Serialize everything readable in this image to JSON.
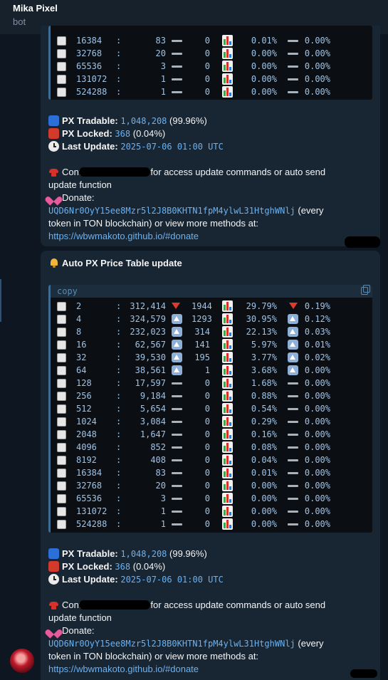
{
  "chat": {
    "name": "Mika Pixel",
    "subtitle": "bot"
  },
  "message1": {
    "table_rows": [
      {
        "power": "16384",
        "count": "83",
        "diff": "0",
        "diff_dir": "flat",
        "pct": "0.01%",
        "pct_change": "0.00%",
        "pct_dir": "flat"
      },
      {
        "power": "32768",
        "count": "20",
        "diff": "0",
        "diff_dir": "flat",
        "pct": "0.00%",
        "pct_change": "0.00%",
        "pct_dir": "flat"
      },
      {
        "power": "65536",
        "count": "3",
        "diff": "0",
        "diff_dir": "flat",
        "pct": "0.00%",
        "pct_change": "0.00%",
        "pct_dir": "flat"
      },
      {
        "power": "131072",
        "count": "1",
        "diff": "0",
        "diff_dir": "flat",
        "pct": "0.00%",
        "pct_change": "0.00%",
        "pct_dir": "flat"
      },
      {
        "power": "524288",
        "count": "1",
        "diff": "0",
        "diff_dir": "flat",
        "pct": "0.00%",
        "pct_change": "0.00%",
        "pct_dir": "flat"
      }
    ]
  },
  "message2": {
    "title": "Auto PX Price Table update",
    "copy_label": "copy",
    "table_rows": [
      {
        "power": "2",
        "count": "312,414",
        "diff": "1944",
        "diff_dir": "down",
        "pct": "29.79%",
        "pct_change": "0.19%",
        "pct_dir": "down"
      },
      {
        "power": "4",
        "count": "324,579",
        "diff": "1293",
        "diff_dir": "up",
        "pct": "30.95%",
        "pct_change": "0.12%",
        "pct_dir": "up"
      },
      {
        "power": "8",
        "count": "232,023",
        "diff": "314",
        "diff_dir": "up",
        "pct": "22.13%",
        "pct_change": "0.03%",
        "pct_dir": "up"
      },
      {
        "power": "16",
        "count": "62,567",
        "diff": "141",
        "diff_dir": "up",
        "pct": "5.97%",
        "pct_change": "0.01%",
        "pct_dir": "up"
      },
      {
        "power": "32",
        "count": "39,530",
        "diff": "195",
        "diff_dir": "up",
        "pct": "3.77%",
        "pct_change": "0.02%",
        "pct_dir": "up"
      },
      {
        "power": "64",
        "count": "38,561",
        "diff": "1",
        "diff_dir": "up",
        "pct": "3.68%",
        "pct_change": "0.00%",
        "pct_dir": "up"
      },
      {
        "power": "128",
        "count": "17,597",
        "diff": "0",
        "diff_dir": "flat",
        "pct": "1.68%",
        "pct_change": "0.00%",
        "pct_dir": "flat"
      },
      {
        "power": "256",
        "count": "9,184",
        "diff": "0",
        "diff_dir": "flat",
        "pct": "0.88%",
        "pct_change": "0.00%",
        "pct_dir": "flat"
      },
      {
        "power": "512",
        "count": "5,654",
        "diff": "0",
        "diff_dir": "flat",
        "pct": "0.54%",
        "pct_change": "0.00%",
        "pct_dir": "flat"
      },
      {
        "power": "1024",
        "count": "3,084",
        "diff": "0",
        "diff_dir": "flat",
        "pct": "0.29%",
        "pct_change": "0.00%",
        "pct_dir": "flat"
      },
      {
        "power": "2048",
        "count": "1,647",
        "diff": "0",
        "diff_dir": "flat",
        "pct": "0.16%",
        "pct_change": "0.00%",
        "pct_dir": "flat"
      },
      {
        "power": "4096",
        "count": "852",
        "diff": "0",
        "diff_dir": "flat",
        "pct": "0.08%",
        "pct_change": "0.00%",
        "pct_dir": "flat"
      },
      {
        "power": "8192",
        "count": "408",
        "diff": "0",
        "diff_dir": "flat",
        "pct": "0.04%",
        "pct_change": "0.00%",
        "pct_dir": "flat"
      },
      {
        "power": "16384",
        "count": "83",
        "diff": "0",
        "diff_dir": "flat",
        "pct": "0.01%",
        "pct_change": "0.00%",
        "pct_dir": "flat"
      },
      {
        "power": "32768",
        "count": "20",
        "diff": "0",
        "diff_dir": "flat",
        "pct": "0.00%",
        "pct_change": "0.00%",
        "pct_dir": "flat"
      },
      {
        "power": "65536",
        "count": "3",
        "diff": "0",
        "diff_dir": "flat",
        "pct": "0.00%",
        "pct_change": "0.00%",
        "pct_dir": "flat"
      },
      {
        "power": "131072",
        "count": "1",
        "diff": "0",
        "diff_dir": "flat",
        "pct": "0.00%",
        "pct_change": "0.00%",
        "pct_dir": "flat"
      },
      {
        "power": "524288",
        "count": "1",
        "diff": "0",
        "diff_dir": "flat",
        "pct": "0.00%",
        "pct_change": "0.00%",
        "pct_dir": "flat"
      }
    ]
  },
  "info": {
    "tradable_label": "PX Tradable:",
    "tradable_value": "1,048,208",
    "tradable_pct": "(99.96%)",
    "locked_label": "PX Locked:",
    "locked_value": "368",
    "locked_pct": "(0.04%)",
    "update_label": "Last Update:",
    "update_value": "2025-07-06 01:00 UTC",
    "contact_label": "Contact:",
    "contact_text": "for access update commands or auto send",
    "contact_text2": "update function",
    "donate_label": "Donate:",
    "donate_address": "UQD6Nr0OyY15ee8Mzr5l2J8B0KHTN1fpM4ylwL31HtghWNlj",
    "donate_text": "(every",
    "donate_text2": "token in TON blockchain) or view more methods at:",
    "donate_link": "https://wbwmakoto.github.io/#donate"
  },
  "icons": {
    "tradable": "blue-square-icon",
    "locked": "red-square-icon",
    "update": "clock-icon",
    "contact": "telephone-icon",
    "donate": "heart-gift-icon",
    "title": "bell-icon",
    "copy": "copy-icon",
    "up": "up-arrow-icon",
    "down": "red-down-triangle-icon",
    "flat": "dash-icon",
    "row": "white-square-icon",
    "chart": "chart-icon"
  },
  "colors": {
    "background": "#0e1621",
    "bubble": "#182533",
    "accent": "#6ab2f2"
  }
}
